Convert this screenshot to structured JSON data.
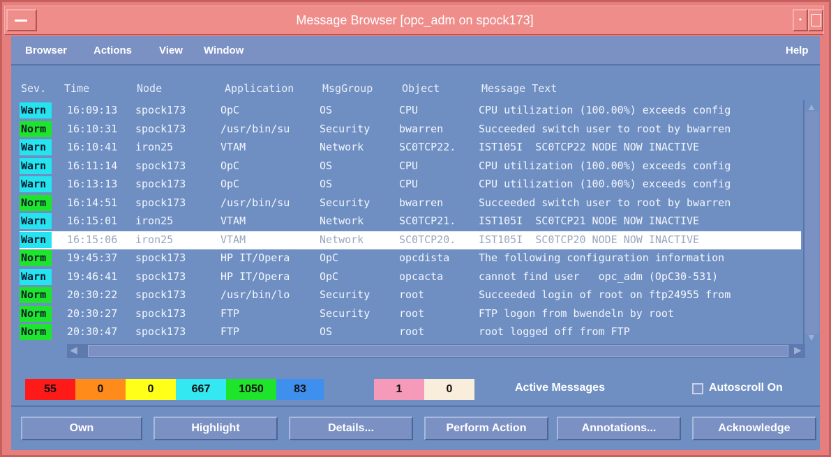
{
  "window": {
    "title": "Message Browser  [opc_adm on spock173]"
  },
  "menubar": {
    "items": [
      "Browser",
      "Actions",
      "View",
      "Window"
    ],
    "help": "Help"
  },
  "columns": [
    "Sev.",
    "Time",
    "Node",
    "Application",
    "MsgGroup",
    "Object",
    "Message Text"
  ],
  "rows": [
    {
      "sev": "Warn",
      "time": "16:09:13",
      "node": "spock173",
      "app": "OpC",
      "group": "OS",
      "object": "CPU",
      "text": "CPU utilization (100.00%) exceeds config"
    },
    {
      "sev": "Norm",
      "time": "16:10:31",
      "node": "spock173",
      "app": "/usr/bin/su",
      "group": "Security",
      "object": "bwarren",
      "text": "Succeeded switch user to root by bwarren"
    },
    {
      "sev": "Warn",
      "time": "16:10:41",
      "node": "iron25",
      "app": "VTAM",
      "group": "Network",
      "object": "SC0TCP22.",
      "text": "IST105I  SC0TCP22 NODE NOW INACTIVE"
    },
    {
      "sev": "Warn",
      "time": "16:11:14",
      "node": "spock173",
      "app": "OpC",
      "group": "OS",
      "object": "CPU",
      "text": "CPU utilization (100.00%) exceeds config"
    },
    {
      "sev": "Warn",
      "time": "16:13:13",
      "node": "spock173",
      "app": "OpC",
      "group": "OS",
      "object": "CPU",
      "text": "CPU utilization (100.00%) exceeds config"
    },
    {
      "sev": "Norm",
      "time": "16:14:51",
      "node": "spock173",
      "app": "/usr/bin/su",
      "group": "Security",
      "object": "bwarren",
      "text": "Succeeded switch user to root by bwarren"
    },
    {
      "sev": "Warn",
      "time": "16:15:01",
      "node": "iron25",
      "app": "VTAM",
      "group": "Network",
      "object": "SC0TCP21.",
      "text": "IST105I  SC0TCP21 NODE NOW INACTIVE"
    },
    {
      "sev": "Warn",
      "time": "16:15:06",
      "node": "iron25",
      "app": "VTAM",
      "group": "Network",
      "object": "SC0TCP20.",
      "text": "IST105I  SC0TCP20 NODE NOW INACTIVE"
    },
    {
      "sev": "Norm",
      "time": "19:45:37",
      "node": "spock173",
      "app": "HP IT/Opera",
      "group": "OpC",
      "object": "opcdista",
      "text": "The following configuration information"
    },
    {
      "sev": "Warn",
      "time": "19:46:41",
      "node": "spock173",
      "app": "HP IT/Opera",
      "group": "OpC",
      "object": "opcacta",
      "text": "cannot find user   opc_adm (OpC30-531)"
    },
    {
      "sev": "Norm",
      "time": "20:30:22",
      "node": "spock173",
      "app": "/usr/bin/lo",
      "group": "Security",
      "object": "root",
      "text": "Succeeded login of root on ftp24955 from"
    },
    {
      "sev": "Norm",
      "time": "20:30:27",
      "node": "spock173",
      "app": "FTP",
      "group": "Security",
      "object": "root",
      "text": "FTP logon from bwendeln by root"
    },
    {
      "sev": "Norm",
      "time": "20:30:47",
      "node": "spock173",
      "app": "FTP",
      "group": "OS",
      "object": "root",
      "text": "root logged off from FTP"
    }
  ],
  "selected_row": 7,
  "counters": [
    {
      "value": "55",
      "color": "#ff1a1a"
    },
    {
      "value": "0",
      "color": "#ff8c1a"
    },
    {
      "value": "0",
      "color": "#ffff1a"
    },
    {
      "value": "667",
      "color": "#33e8f0"
    },
    {
      "value": "1050",
      "color": "#1ee52c"
    },
    {
      "value": "83",
      "color": "#3f8fef"
    }
  ],
  "extra_counters": [
    {
      "value": "1",
      "color": "#f59ab8"
    },
    {
      "value": "0",
      "color": "#f9eedc"
    }
  ],
  "active_messages_label": "Active Messages",
  "autoscroll_label": "Autoscroll On",
  "buttons": [
    "Own",
    "Highlight",
    "Details...",
    "Perform Action",
    "Annotations...",
    "Acknowledge"
  ]
}
